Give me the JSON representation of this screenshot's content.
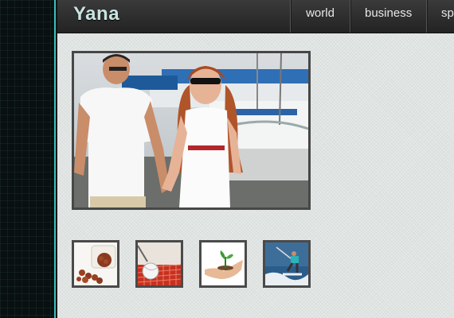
{
  "site": {
    "logo": "Yana"
  },
  "nav": {
    "items": [
      "world",
      "business",
      "sp"
    ]
  },
  "images": {
    "main": "couple-photo",
    "thumbnails": [
      "pills-thumbnail",
      "tennis-thumbnail",
      "plant-in-hand-thumbnail",
      "kitesurf-thumbnail"
    ]
  }
}
